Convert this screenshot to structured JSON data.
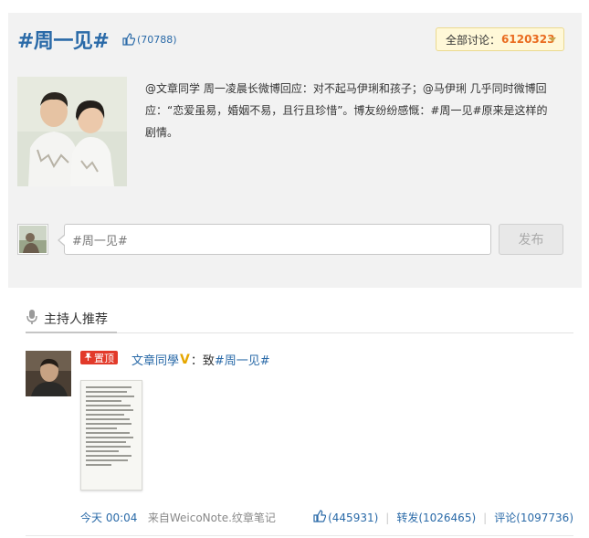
{
  "topic": {
    "title": "#周一见#",
    "like_count": "(70788)",
    "discuss_label": "全部讨论：",
    "discuss_count": "6120323",
    "description": "@文章同学 周一凌晨长微博回应：对不起马伊琍和孩子；@马伊琍 几乎同时微博回应：“恋爱虽易，婚姻不易，且行且珍惜”。博友纷纷感慨：#周一见#原来是这样的剧情。",
    "input_value": "#周一见#",
    "publish_label": "发布"
  },
  "host": {
    "title": "主持人推荐"
  },
  "feed": {
    "pin_label": "置顶",
    "user": "文章同學",
    "verified_mark": "V",
    "text_prefix": "：致 ",
    "tag": "#周一见#",
    "time": "今天 00:04",
    "source": "来自WeicoNote.纹章笔记",
    "likes": "(445931)",
    "reposts": "转发(1026465)",
    "comments": "评论(1097736)"
  },
  "colors": {
    "link": "#2a6aa8",
    "accent": "#e96b1f",
    "pin": "#e23a2a"
  }
}
